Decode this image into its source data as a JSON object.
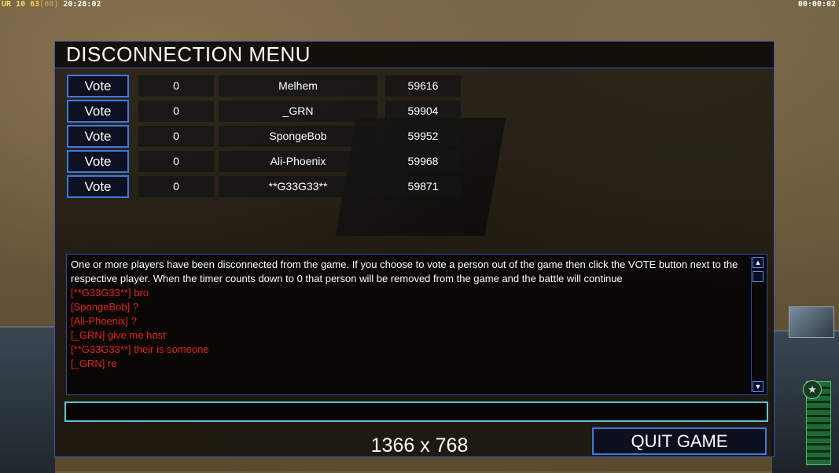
{
  "status_bar": {
    "ur_label": "UR",
    "ur_value": "10",
    "fps": "63",
    "fps_limit": "[60]",
    "clock": "20:28:02",
    "timer": "00:00:02"
  },
  "hud": {
    "star_icon": "star-icon",
    "satellite_thumb": "satellite-image",
    "meter_label": "power-meter"
  },
  "dialog": {
    "title": "DISCONNECTION MENU",
    "players": [
      {
        "vote_label": "Vote",
        "count": "0",
        "name": "Melhem",
        "ping": "59616"
      },
      {
        "vote_label": "Vote",
        "count": "0",
        "name": "_GRN",
        "ping": "59904"
      },
      {
        "vote_label": "Vote",
        "count": "0",
        "name": "SpongeBob",
        "ping": "59952"
      },
      {
        "vote_label": "Vote",
        "count": "0",
        "name": "Ali-Phoenix",
        "ping": "59968"
      },
      {
        "vote_label": "Vote",
        "count": "0",
        "name": "**G33G33**",
        "ping": "59871"
      }
    ],
    "messages": {
      "system": "One or more players have been disconnected from the game. If you choose to vote a person out of the game then click the VOTE button next to the respective player. When the timer counts down to 0 that person will be removed from the game and the battle will continue",
      "chat": [
        "[**G33G33**] bro",
        "[SpongeBob] ?",
        "[Ali-Phoenix] ?",
        "[_GRN] give me host",
        "[**G33G33**] their is someone",
        "[_GRN] re"
      ]
    },
    "chat_input": {
      "value": "",
      "placeholder": ""
    },
    "resolution": "1366 x 768",
    "quit_label": "QUIT GAME"
  },
  "colors": {
    "accent_border": "#3d78e0",
    "chat_text": "#e0261a",
    "input_border": "#61c3d4"
  }
}
